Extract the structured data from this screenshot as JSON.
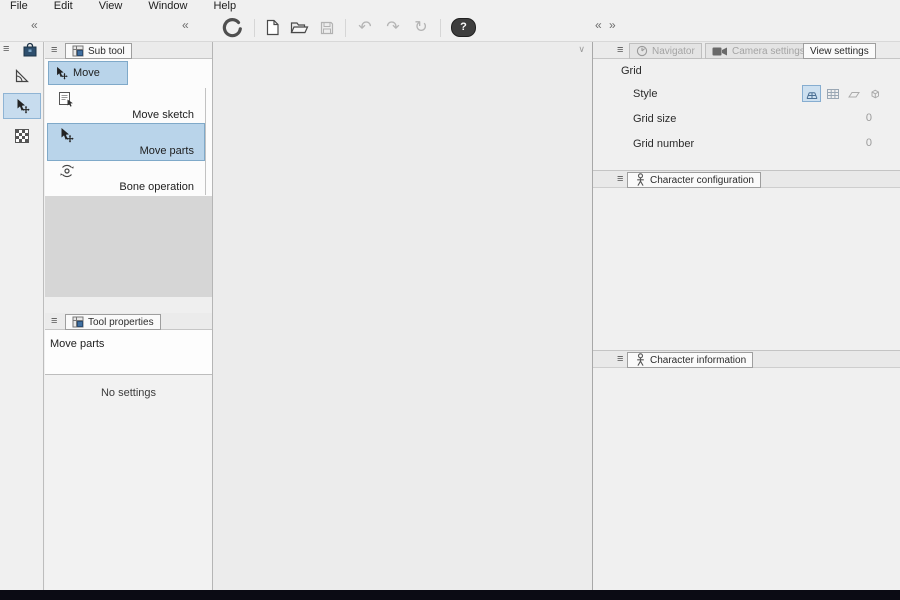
{
  "glyphs": {
    "collapse_left": "«",
    "collapse_right": "»",
    "panel_menu": "≡",
    "dropdown": "∨",
    "undo": "↶",
    "redo": "↷",
    "reset": "↻",
    "help": "?"
  },
  "menubar": {
    "items": [
      {
        "label": "File"
      },
      {
        "label": "Edit"
      },
      {
        "label": "View"
      },
      {
        "label": "Window"
      },
      {
        "label": "Help"
      }
    ]
  },
  "subtool": {
    "tab": "Sub tool",
    "group": "Move",
    "items": [
      {
        "label": "Move sketch",
        "selected": false
      },
      {
        "label": "Move parts",
        "selected": true
      },
      {
        "label": "Bone operation",
        "selected": false
      }
    ]
  },
  "tool_properties": {
    "tab": "Tool properties",
    "selected_tool": "Move parts",
    "empty_message": "No settings"
  },
  "right_panel": {
    "tabs": [
      {
        "label": "Navigator",
        "state": "inactive"
      },
      {
        "label": "Camera settings",
        "state": "inactive"
      },
      {
        "label": "View settings",
        "state": "active"
      }
    ],
    "view_settings": {
      "section_title": "Grid",
      "style_label": "Style",
      "grid_size_label": "Grid size",
      "grid_size_value": "0",
      "grid_number_label": "Grid number",
      "grid_number_value": "0"
    },
    "character_configuration": {
      "tab": "Character configuration"
    },
    "character_information": {
      "tab": "Character information"
    }
  },
  "colors": {
    "selection_fill": "#b9d4ea",
    "selection_border": "#7fa9c9",
    "statusbar": "#0b0b14"
  }
}
